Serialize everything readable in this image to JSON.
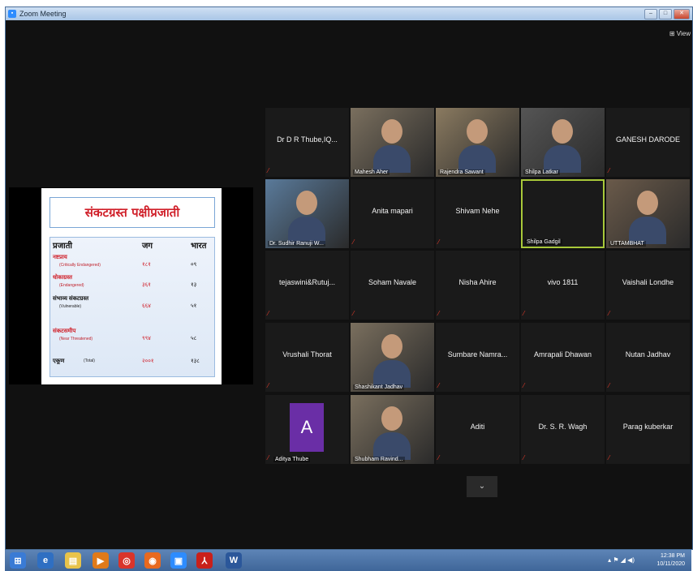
{
  "window": {
    "title": "Zoom Meeting",
    "view_label": "View"
  },
  "slide": {
    "title": "संकटग्रस्त पक्षीप्रजाती",
    "headers": [
      "प्रजाती",
      "जग",
      "भारत"
    ],
    "rows": [
      {
        "label": "नष्टप्राय",
        "sub": "(Critically Endangered)",
        "world": "१८१",
        "india": "०९"
      },
      {
        "label": "धोकाग्रस्त",
        "sub": "(Endangered)",
        "world": "३६१",
        "india": "१३"
      },
      {
        "label": "संभाव्य संकटग्रस्त",
        "sub": "(Vulnerable)",
        "world": "६६४",
        "india": "५१"
      },
      {
        "label": "संकटसमीप",
        "sub": "(Near Threatened)",
        "world": "९९४",
        "india": "५८"
      },
      {
        "label": "एकूण",
        "sub": "(Total)",
        "world": "२००१",
        "india": "१३८"
      }
    ]
  },
  "participants": [
    {
      "name": "Dr D R Thube,IQ...",
      "video": false
    },
    {
      "name": "Mahesh Aher",
      "video": true
    },
    {
      "name": "Rajendra Sawant",
      "video": true
    },
    {
      "name": "Shilpa Latkar",
      "video": true
    },
    {
      "name": "GANESH DARODE",
      "video": false
    },
    {
      "name": "Dr. Sudhir Ranuji W...",
      "video": true
    },
    {
      "name": "Anita mapari",
      "video": false
    },
    {
      "name": "Shivam Nehe",
      "video": false
    },
    {
      "name": "Shilpa Gadgil",
      "video": true,
      "active": true
    },
    {
      "name": "UTTAMBHAT",
      "video": true
    },
    {
      "name": "tejaswini&Rutuj...",
      "video": false
    },
    {
      "name": "Soham Navale",
      "video": false
    },
    {
      "name": "Nisha Ahire",
      "video": false
    },
    {
      "name": "vivo 1811",
      "video": false
    },
    {
      "name": "Vaishali Londhe",
      "video": false
    },
    {
      "name": "Vrushali Thorat",
      "video": false
    },
    {
      "name": "Shashikant Jadhav",
      "video": true
    },
    {
      "name": "Sumbare Namra...",
      "video": false
    },
    {
      "name": "Amrapali Dhawan",
      "video": false
    },
    {
      "name": "Nutan Jadhav",
      "video": false
    },
    {
      "name": "Aditya Thube",
      "video": "avatar",
      "initial": "A"
    },
    {
      "name": "Shubham Ravind...",
      "video": true
    },
    {
      "name": "Aditi",
      "video": false
    },
    {
      "name": "Dr. S. R. Wagh",
      "video": false
    },
    {
      "name": "Parag kuberkar",
      "video": false
    }
  ],
  "taskbar": {
    "time": "12:38 PM",
    "date": "10/11/2020"
  }
}
